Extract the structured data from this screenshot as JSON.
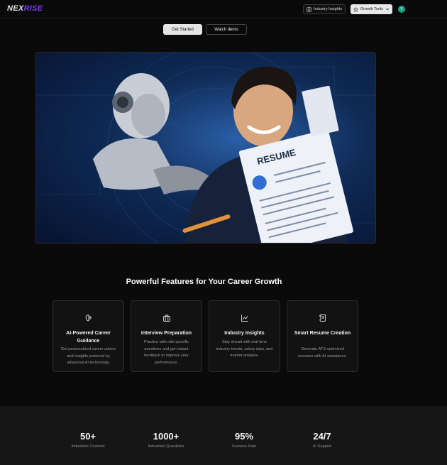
{
  "nav": {
    "logo_a": "NEX",
    "logo_b": "RISE",
    "insights_label": "Industry Insights",
    "growth_label": "Growth Tools",
    "avatar_initial": "V"
  },
  "hero": {
    "primary_cta": "Get Started",
    "secondary_cta": "Watch demo",
    "image_text": "RESUME"
  },
  "features": {
    "title": "Powerful Features for Your Career Growth",
    "cards": [
      {
        "icon": "brain-icon",
        "title": "AI-Powered Career Guidance",
        "desc": "Get personalized career advice and insights powered by advanced AI technology."
      },
      {
        "icon": "briefcase-icon",
        "title": "Interview Preparation",
        "desc": "Practice with role-specific questions and get instant feedback to improve your performance."
      },
      {
        "icon": "line-chart-icon",
        "title": "Industry Insights",
        "desc": "Stay ahead with real-time industry trends, salary data, and market analysis."
      },
      {
        "icon": "scroll-icon",
        "title": "Smart Resume Creation",
        "desc": "Generate ATS-optimized resumes with AI assistance."
      }
    ]
  },
  "stats": [
    {
      "value": "50+",
      "label": "Industries Covered"
    },
    {
      "value": "1000+",
      "label": "Industries Questions"
    },
    {
      "value": "95%",
      "label": "Success Rate"
    },
    {
      "value": "24/7",
      "label": "AI Support"
    }
  ],
  "colors": {
    "brand": "#7c3aed",
    "avatar": "#16a37f",
    "background": "#0a0a0a"
  }
}
